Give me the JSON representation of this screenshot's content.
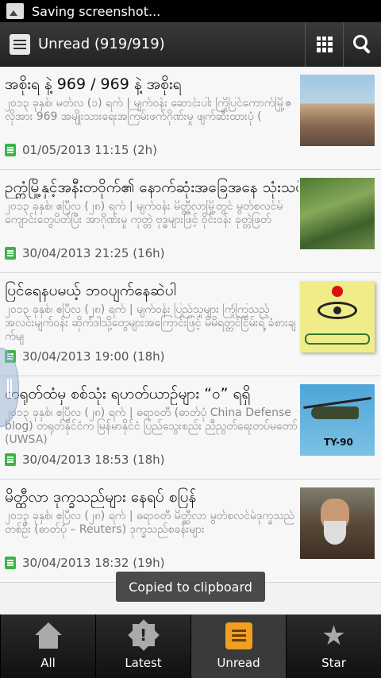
{
  "status_bar": {
    "text": "Saving screenshot..."
  },
  "action_bar": {
    "title": "Unread (919/919)"
  },
  "articles": [
    {
      "title": "အစိုးရ နဲ့ 969 / 969 နဲ့ အစိုးရ",
      "snippet": "၂၀၁၃ ခုနှစ်၊ မတ်လ (၁) ရက် | မျက်ဝန်း ဆောင်းပါး ကြိုပြင်ကောက်မြို့ဇလိုအား 969 အမျိုးသားရေးအကြမ်းဖက်ဂိုဏ်းမှု ဖျက်ဆီးထားပုံ (",
      "date": "01/05/2013 11:15 (2h)"
    },
    {
      "title": "ဉက္ကံမြို့နှင့်အနီးတဝိုက်၏ နောက်ဆုံးအခြေအနေ သုံးသပ်ချက်",
      "snippet": "၂၀၁၃ ခုနှစ်၊ ဧပြီလ (၂၈) ရက် | မျက်ဝန်း မိတ္ထီလာမြို့တွင် မွတ်စလင်မ် ကျောင်းတွေပိတ်ပြီး အာဂိုဏ်းမှု ကုတ္တဲ ဗုဒ္ဓများဖြင့် ဝိုင်းဝန်း ခုတ္တဲဖြတ်",
      "date": "30/04/2013 21:25 (16h)"
    },
    {
      "title": "ပြင်ရေနပမယ့် ဘဝပျက်နေဆဲပါ",
      "snippet": "၂၀၁၃ ခုနှစ်၊ ဧပြီလ (၂၈) ရက် | မျက်ဝန်း ပြည်သူများ ကြုံကြသည့် အလင်းမျက်ဝန်း ဆိုက်ဒါသို့တွေများအကြောင်းဖြင့် မိမိရတ္တင်ငြိမ်းရဲ့ ခံစားချက်မျ",
      "date": "30/04/2013 19:00 (18h)"
    },
    {
      "title": "တရုတ်ထံမှ စစ်သုံး ရဟတ်ယာဉ်များ “၀” ရရှိ",
      "snippet": "၂၀၁၃ ခုနှစ်၊ ဧပြီလ (၂၈) ရက် | ဓရာဝတီ (ဓာတ်ပုံ China Defense blog) တရုတ်နိုင်ငံက မြန်မာနိုင်ငံ ပြည်သွေးစည်း ညီညွတ်ရေးတပ်မတော် (UWSA)",
      "date": "30/04/2013 18:53 (18h)"
    },
    {
      "title": "မိတ္ထီလာ ဒုက္ခသည်များ နေရပ် စပြန်",
      "snippet": "၂၀၁၃ ခုနှစ်၊ ဧပြီလ (၂၈) ရက် | ဓရာဝတီ မိတ္ထီလာ မွတ်စလင်မ်ဒုက္ခသည်တစ်ဦး (ဓာတ်ပုံ – Reuters) ဒုက္ခသည်စခန်းများ",
      "date": "30/04/2013 18:32 (19h)"
    }
  ],
  "thumb_labels": {
    "item4_tag": "TY-90"
  },
  "toast": {
    "text": "Copied to clipboard"
  },
  "tabs": [
    {
      "label": "All",
      "icon": "home-icon"
    },
    {
      "label": "Latest",
      "icon": "burst-icon"
    },
    {
      "label": "Unread",
      "icon": "unread-icon"
    },
    {
      "label": "Star",
      "icon": "star-icon"
    }
  ],
  "colors": {
    "accent": "#f0a020",
    "doc_icon": "#3cb44a",
    "action_bar": "#2b2b2b"
  }
}
